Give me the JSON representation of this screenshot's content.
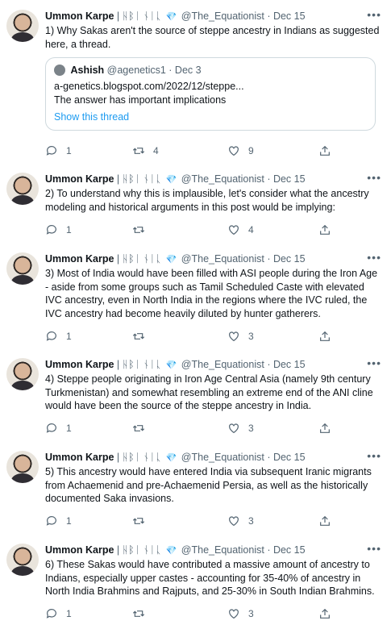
{
  "tweets": [
    {
      "name": "Ummon Karpe",
      "script": "| ᚺᛒᛁ ᚾᛁᚳ",
      "handle": "@The_Equationist",
      "date": "· Dec 15",
      "text": "1) Why Sakas aren't the source of steppe ancestry in Indians as suggested here, a thread.",
      "replies": "1",
      "retweets": "4",
      "likes": "9",
      "quote": {
        "name": "Ashish",
        "handle": "@agenetics1",
        "date": "· Dec 3",
        "line1": "a-genetics.blogspot.com/2022/12/steppe...",
        "line2": "The answer has important implications",
        "show_thread": "Show this thread"
      }
    },
    {
      "name": "Ummon Karpe",
      "script": "| ᚺᛒᛁ ᚾᛁᚳ",
      "handle": "@The_Equationist",
      "date": "· Dec 15",
      "text": "2) To understand why this is implausible, let's consider what the ancestry modeling and historical arguments in this post would be implying:",
      "replies": "1",
      "retweets": "",
      "likes": "4"
    },
    {
      "name": "Ummon Karpe",
      "script": "| ᚺᛒᛁ ᚾᛁᚳ",
      "handle": "@The_Equationist",
      "date": "· Dec 15",
      "text": "3) Most of India would have been filled with ASI people during the Iron Age - aside from some groups such as Tamil Scheduled Caste with elevated IVC ancestry, even in North India in the regions where the IVC ruled, the IVC ancestry had become heavily diluted by hunter gatherers.",
      "replies": "1",
      "retweets": "",
      "likes": "3"
    },
    {
      "name": "Ummon Karpe",
      "script": "| ᚺᛒᛁ ᚾᛁᚳ",
      "handle": "@The_Equationist",
      "date": "· Dec 15",
      "text": "4) Steppe people originating in Iron Age Central Asia (namely 9th century Turkmenistan) and somewhat resembling an extreme end of the ANI cline would have been the source of the steppe ancestry in India.",
      "replies": "1",
      "retweets": "",
      "likes": "3"
    },
    {
      "name": "Ummon Karpe",
      "script": "| ᚺᛒᛁ ᚾᛁᚳ",
      "handle": "@The_Equationist",
      "date": "· Dec 15",
      "text": "5) This ancestry would have entered India via subsequent Iranic migrants from Achaemenid and pre-Achaemenid Persia, as well as the historically documented Saka invasions.",
      "replies": "1",
      "retweets": "",
      "likes": "3"
    },
    {
      "name": "Ummon Karpe",
      "script": "| ᚺᛒᛁ ᚾᛁᚳ",
      "handle": "@The_Equationist",
      "date": "· Dec 15",
      "text": "6) These Sakas would have contributed a massive amount of ancestry to Indians, especially upper castes - accounting for 35-40% of ancestry in North India Brahmins and Rajputs, and 25-30% in South Indian Brahmins.",
      "replies": "1",
      "retweets": "",
      "likes": "3"
    }
  ],
  "icons": {
    "badge": "verified-diamond-icon",
    "more": "more-horizontal-icon",
    "reply": "reply-icon",
    "retweet": "retweet-icon",
    "like": "heart-icon",
    "share": "share-icon"
  },
  "colors": {
    "text": "#0f1419",
    "secondary": "#536471",
    "link": "#1d9bf0",
    "badge": "#3fa9f5",
    "border": "#cfd9de"
  }
}
